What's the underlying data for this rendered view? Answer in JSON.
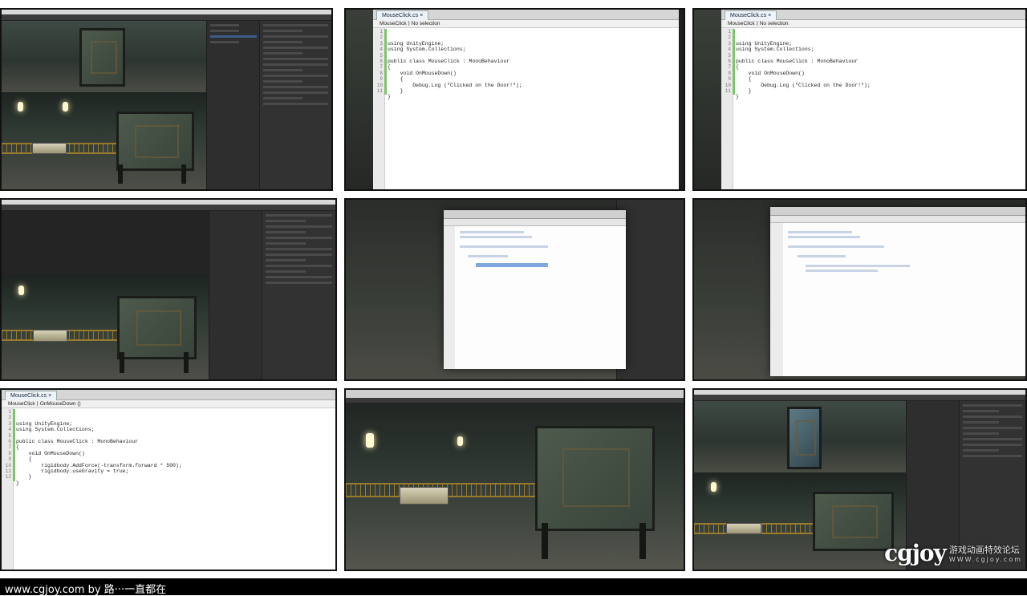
{
  "editor_tab": "MouseClick.cs",
  "editor_tab_close": "×",
  "crumb_no_selection": "MouseClick ⟩ No selection",
  "crumb_method": "MouseClick ⟩ OnMouseDown ()",
  "code_a": {
    "lines": [
      "using UnityEngine;",
      "using System.Collections;",
      "",
      "public class MouseClick : MonoBehaviour",
      "{",
      "    void OnMouseDown()",
      "    {",
      "        Debug.Log (\"Clicked on the Door!\");",
      "    }",
      "}",
      ""
    ],
    "line_numbers": [
      "1",
      "2",
      "3",
      "4",
      "5",
      "6",
      "7",
      "8",
      "9",
      "10",
      "11"
    ]
  },
  "code_b": {
    "lines": [
      "using UnityEngine;",
      "using System.Collections;",
      "",
      "public class MouseClick : MonoBehaviour",
      "{",
      "    void OnMouseDown()",
      "    {",
      "        rigidbody.AddForce(-transform.forward * 500);",
      "        rigidbody.useGravity = true;",
      "    }",
      "}",
      ""
    ],
    "line_numbers": [
      "1",
      "2",
      "3",
      "4",
      "5",
      "6",
      "7",
      "8",
      "9",
      "10",
      "11",
      "12"
    ]
  },
  "watermark": {
    "logo": "cgjoy",
    "cn": "游戏动画特效论坛",
    "url": "WWW.cgjoy.com"
  },
  "footer_text": "www.cgjoy.com by 路···一直都在"
}
